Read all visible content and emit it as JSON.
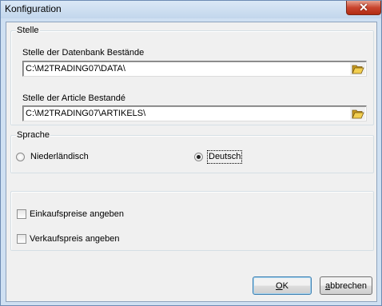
{
  "window": {
    "title": "Konfiguration",
    "close_glyph": "✕"
  },
  "location_group": {
    "legend": "Stelle",
    "database": {
      "label": "Stelle der Datenbank Bestände",
      "value": "C:\\M2TRADING07\\DATA\\"
    },
    "articles": {
      "label": "Stelle der Article Bestandé",
      "value": "C:\\M2TRADING07\\ARTIKELS\\"
    }
  },
  "language_group": {
    "legend": "Sprache",
    "options": [
      {
        "label": "Niederländisch",
        "selected": false
      },
      {
        "label": "Deutsch",
        "selected": true
      }
    ]
  },
  "options_group": {
    "purchase_price": {
      "label": "Einkaufspreise angeben",
      "checked": false
    },
    "sale_price": {
      "label": "Verkaufspreis angeben",
      "checked": false
    }
  },
  "buttons": {
    "ok_mnemonic": "O",
    "ok_rest": "K",
    "cancel_mnemonic": "a",
    "cancel_rest": "bbrechen"
  },
  "icons": {
    "folder": "folder-open-icon",
    "close": "close-icon"
  },
  "colors": {
    "title_bar": "#cfe0f2",
    "close_button": "#c8452f",
    "folder": "#e8c040"
  }
}
